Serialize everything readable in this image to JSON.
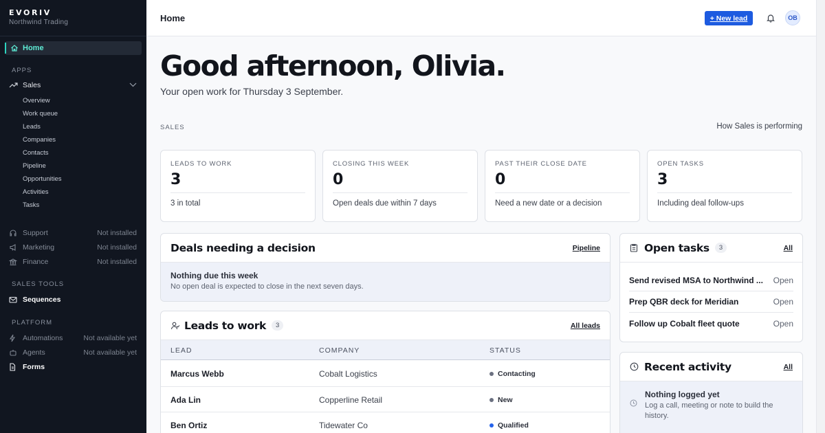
{
  "brand": {
    "name": "EVORIV",
    "subtitle": "Northwind Trading"
  },
  "sidebar": {
    "home": "Home",
    "apps_label": "APPS",
    "sales": "Sales",
    "sales_items": [
      "Overview",
      "Work queue",
      "Leads",
      "Companies",
      "Contacts",
      "Pipeline",
      "Opportunities",
      "Activities",
      "Tasks"
    ],
    "other_apps": [
      {
        "label": "Support",
        "status": "Not installed"
      },
      {
        "label": "Marketing",
        "status": "Not installed"
      },
      {
        "label": "Finance",
        "status": "Not installed"
      }
    ],
    "sales_tools_label": "SALES TOOLS",
    "sequences": "Sequences",
    "platform_label": "PLATFORM",
    "platform_items": [
      {
        "label": "Automations",
        "status": "Not available yet"
      },
      {
        "label": "Agents",
        "status": "Not available yet"
      },
      {
        "label": "Forms",
        "status": ""
      }
    ]
  },
  "topbar": {
    "title": "Home",
    "new_lead": "+ New lead",
    "avatar": "OB"
  },
  "greeting": {
    "title": "Good afternoon, Olivia.",
    "subtitle": "Your open work for Thursday 3 September."
  },
  "sales": {
    "label": "SALES",
    "link": "How Sales is performing"
  },
  "stats": [
    {
      "label": "LEADS TO WORK",
      "value": "3",
      "note": "3 in total"
    },
    {
      "label": "CLOSING THIS WEEK",
      "value": "0",
      "note": "Open deals due within 7 days"
    },
    {
      "label": "PAST THEIR CLOSE DATE",
      "value": "0",
      "note": "Need a new date or a decision"
    },
    {
      "label": "OPEN TASKS",
      "value": "3",
      "note": "Including deal follow-ups"
    }
  ],
  "deals": {
    "title": "Deals needing a decision",
    "link": "Pipeline",
    "empty_title": "Nothing due this week",
    "empty_text": "No open deal is expected to close in the next seven days."
  },
  "leads": {
    "title": "Leads to work",
    "count": "3",
    "link": "All leads",
    "columns": [
      "LEAD",
      "COMPANY",
      "STATUS"
    ],
    "rows": [
      {
        "lead": "Marcus Webb",
        "company": "Cobalt Logistics",
        "status": "Contacting"
      },
      {
        "lead": "Ada Lin",
        "company": "Copperline Retail",
        "status": "New"
      },
      {
        "lead": "Ben Ortiz",
        "company": "Tidewater Co",
        "status": "Qualified"
      }
    ]
  },
  "tasks": {
    "title": "Open tasks",
    "count": "3",
    "link": "All",
    "items": [
      {
        "title": "Send revised MSA to Northwind ...",
        "status": "Open"
      },
      {
        "title": "Prep QBR deck for Meridian",
        "status": "Open"
      },
      {
        "title": "Follow up Cobalt fleet quote",
        "status": "Open"
      }
    ]
  },
  "activity": {
    "title": "Recent activity",
    "link": "All",
    "empty_title": "Nothing logged yet",
    "empty_text": "Log a call, meeting or note to build the history."
  },
  "colors": {
    "accent": "#2dd4bf",
    "primary": "#1d5be0",
    "sidebar_bg": "#111620"
  }
}
